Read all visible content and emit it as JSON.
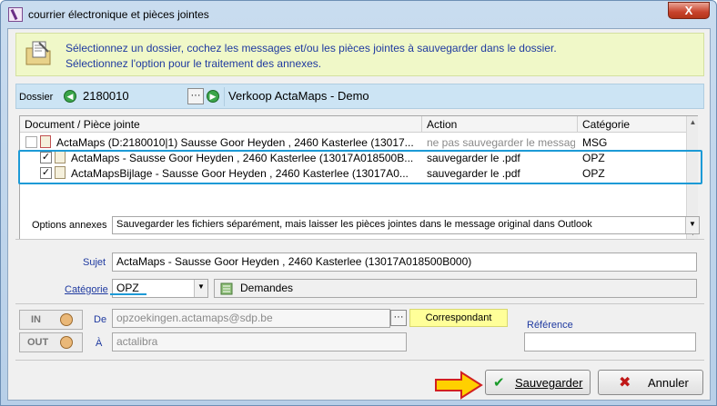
{
  "window": {
    "title": "courrier électronique et pièces jointes",
    "close_label": "X"
  },
  "info": {
    "line1": "Sélectionnez un dossier, cochez les messages et/ou les pièces jointes à sauvegarder dans le dossier.",
    "line2": "Sélectionnez l'option pour le traitement des annexes."
  },
  "dossier": {
    "label": "Dossier",
    "number": "2180010",
    "more_button": "···",
    "name": "Verkoop ActaMaps - Demo"
  },
  "grid": {
    "columns": [
      "Document / Pièce jointe",
      "Action",
      "Catégorie"
    ],
    "rows": [
      {
        "checked": false,
        "document": "ActaMaps (D:2180010|1) Sausse Goor Heyden , 2460 Kasterlee (13017...",
        "action": "ne pas sauvegarder le message",
        "categorie": "MSG",
        "dimmed": true,
        "indent": false
      },
      {
        "checked": true,
        "document": "ActaMaps - Sausse Goor Heyden , 2460 Kasterlee (13017A018500B...",
        "action": "sauvegarder le .pdf",
        "categorie": "OPZ",
        "dimmed": false,
        "indent": true
      },
      {
        "checked": true,
        "document": "ActaMapsBijlage - Sausse Goor Heyden , 2460 Kasterlee (13017A0...",
        "action": "sauvegarder le .pdf",
        "categorie": "OPZ",
        "dimmed": false,
        "indent": true
      }
    ]
  },
  "options": {
    "label": "Options annexes",
    "value": "Sauvegarder les fichiers séparément, mais laisser les pièces jointes dans le message original dans Outlook"
  },
  "form": {
    "sujet_label": "Sujet",
    "sujet_value": "ActaMaps - Sausse Goor Heyden , 2460 Kasterlee (13017A018500B000)",
    "categorie_label": "Catégorie",
    "categorie_value": "OPZ",
    "categorie_name": "Demandes",
    "in_label": "IN",
    "out_label": "OUT",
    "de_label": "De",
    "de_value": "opzoekingen.actamaps@sdp.be",
    "a_label": "À",
    "a_value": "actalibra",
    "correspondant_label": "Correspondant",
    "reference_label": "Référence",
    "reference_value": ""
  },
  "buttons": {
    "save_label": "Sauvegarder",
    "cancel_label": "Annuler"
  },
  "colors": {
    "highlight": "#1c9ad6",
    "info_bg": "#f0f8c8",
    "dossier_bg": "#cce4f4",
    "correspondant_bg": "#ffff99"
  }
}
